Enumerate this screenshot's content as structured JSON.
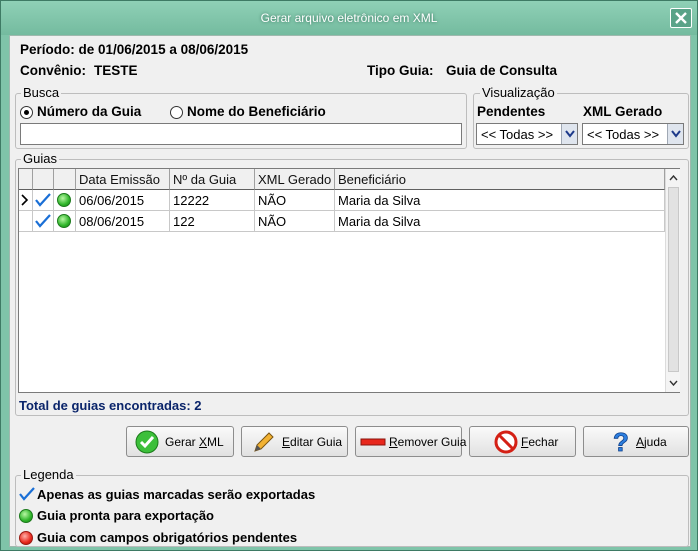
{
  "window": {
    "title": "Gerar arquivo eletrônico em XML"
  },
  "info": {
    "periodo": "Período: de 01/06/2015 a 08/06/2015",
    "convenio_label": "Convênio:",
    "convenio_value": "TESTE",
    "tipo_label": "Tipo Guia:",
    "tipo_value": "Guia de Consulta"
  },
  "busca": {
    "legend": "Busca",
    "option_numero": "Número da Guia",
    "option_nome": "Nome do Beneficiário",
    "selected": "Número da Guia",
    "value": ""
  },
  "visualizacao": {
    "legend": "Visualização",
    "pendentes_label": "Pendentes",
    "pendentes_value": "<< Todas >>",
    "xml_label": "XML Gerado",
    "xml_value": "<< Todas >>"
  },
  "guias": {
    "legend": "Guias",
    "columns": [
      "Data Emissão",
      "Nº da Guia",
      "XML Gerado",
      "Beneficiário"
    ],
    "rows": [
      {
        "data": "06/06/2015",
        "numero": "12222",
        "xml": "NÃO",
        "beneficiario": "Maria da Silva",
        "checked": true,
        "status": "ready",
        "current": true
      },
      {
        "data": "08/06/2015",
        "numero": "122",
        "xml": "NÃO",
        "beneficiario": "Maria da Silva",
        "checked": true,
        "status": "ready",
        "current": false
      }
    ],
    "total": "Total de guias encontradas: 2"
  },
  "buttons": {
    "gerar_pre": "Gerar ",
    "gerar_u": "X",
    "gerar_post": "ML",
    "editar_pre": "",
    "editar_u": "E",
    "editar_post": "ditar Guia",
    "remover_pre": "",
    "remover_u": "R",
    "remover_post": "emover Guia",
    "fechar_pre": "",
    "fechar_u": "F",
    "fechar_post": "echar",
    "ajuda_pre": "",
    "ajuda_u": "A",
    "ajuda_post": "juda"
  },
  "legenda": {
    "legend": "Legenda",
    "item1": "Apenas as guias marcadas serão exportadas",
    "item2": "Guia pronta para exportação",
    "item3": "Guia com campos obrigatórios pendentes"
  },
  "colors": {
    "accent": "#7fc4a9",
    "total_text": "#0a246a",
    "check": "#1a6fd6"
  },
  "icons": [
    "close-icon",
    "check-icon",
    "green-status-icon",
    "red-status-icon",
    "pencil-icon",
    "remove-icon",
    "no-entry-icon",
    "help-icon",
    "chevron-down-icon"
  ]
}
